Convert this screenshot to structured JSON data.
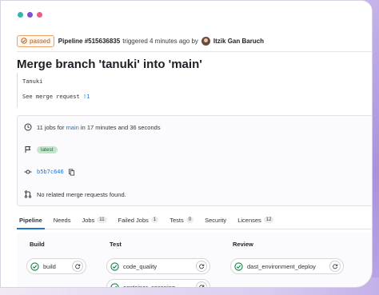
{
  "header": {
    "status_badge": "passed",
    "pipeline_label": "Pipeline #515636835",
    "triggered_text": "triggered 4 minutes ago by",
    "author": "Itzik Gan Baruch"
  },
  "commit": {
    "title": "Merge branch 'tanuki' into 'main'",
    "description_line1": "Tanuki",
    "description_prefix": "See merge request ",
    "description_link": "!1"
  },
  "info": {
    "jobs_prefix": "11 jobs for",
    "branch": "main",
    "jobs_suffix": "in 17 minutes and 36 seconds",
    "tag": "latest",
    "sha": "b5b7c646",
    "merge_requests": "No related merge requests found."
  },
  "tabs": [
    {
      "label": "Pipeline",
      "count": null
    },
    {
      "label": "Needs",
      "count": null
    },
    {
      "label": "Jobs",
      "count": "11"
    },
    {
      "label": "Failed Jobs",
      "count": "1"
    },
    {
      "label": "Tests",
      "count": "0"
    },
    {
      "label": "Security",
      "count": null
    },
    {
      "label": "Licenses",
      "count": "12"
    }
  ],
  "stages": {
    "build": {
      "title": "Build",
      "jobs": [
        "build"
      ]
    },
    "test": {
      "title": "Test",
      "jobs": [
        "code_quality",
        "container_scanning"
      ]
    },
    "review": {
      "title": "Review",
      "jobs": [
        "dast_environment_deploy"
      ]
    }
  },
  "colors": {
    "success": "#108548",
    "link": "#1f75cb",
    "passed_badge": "#b35a17"
  }
}
